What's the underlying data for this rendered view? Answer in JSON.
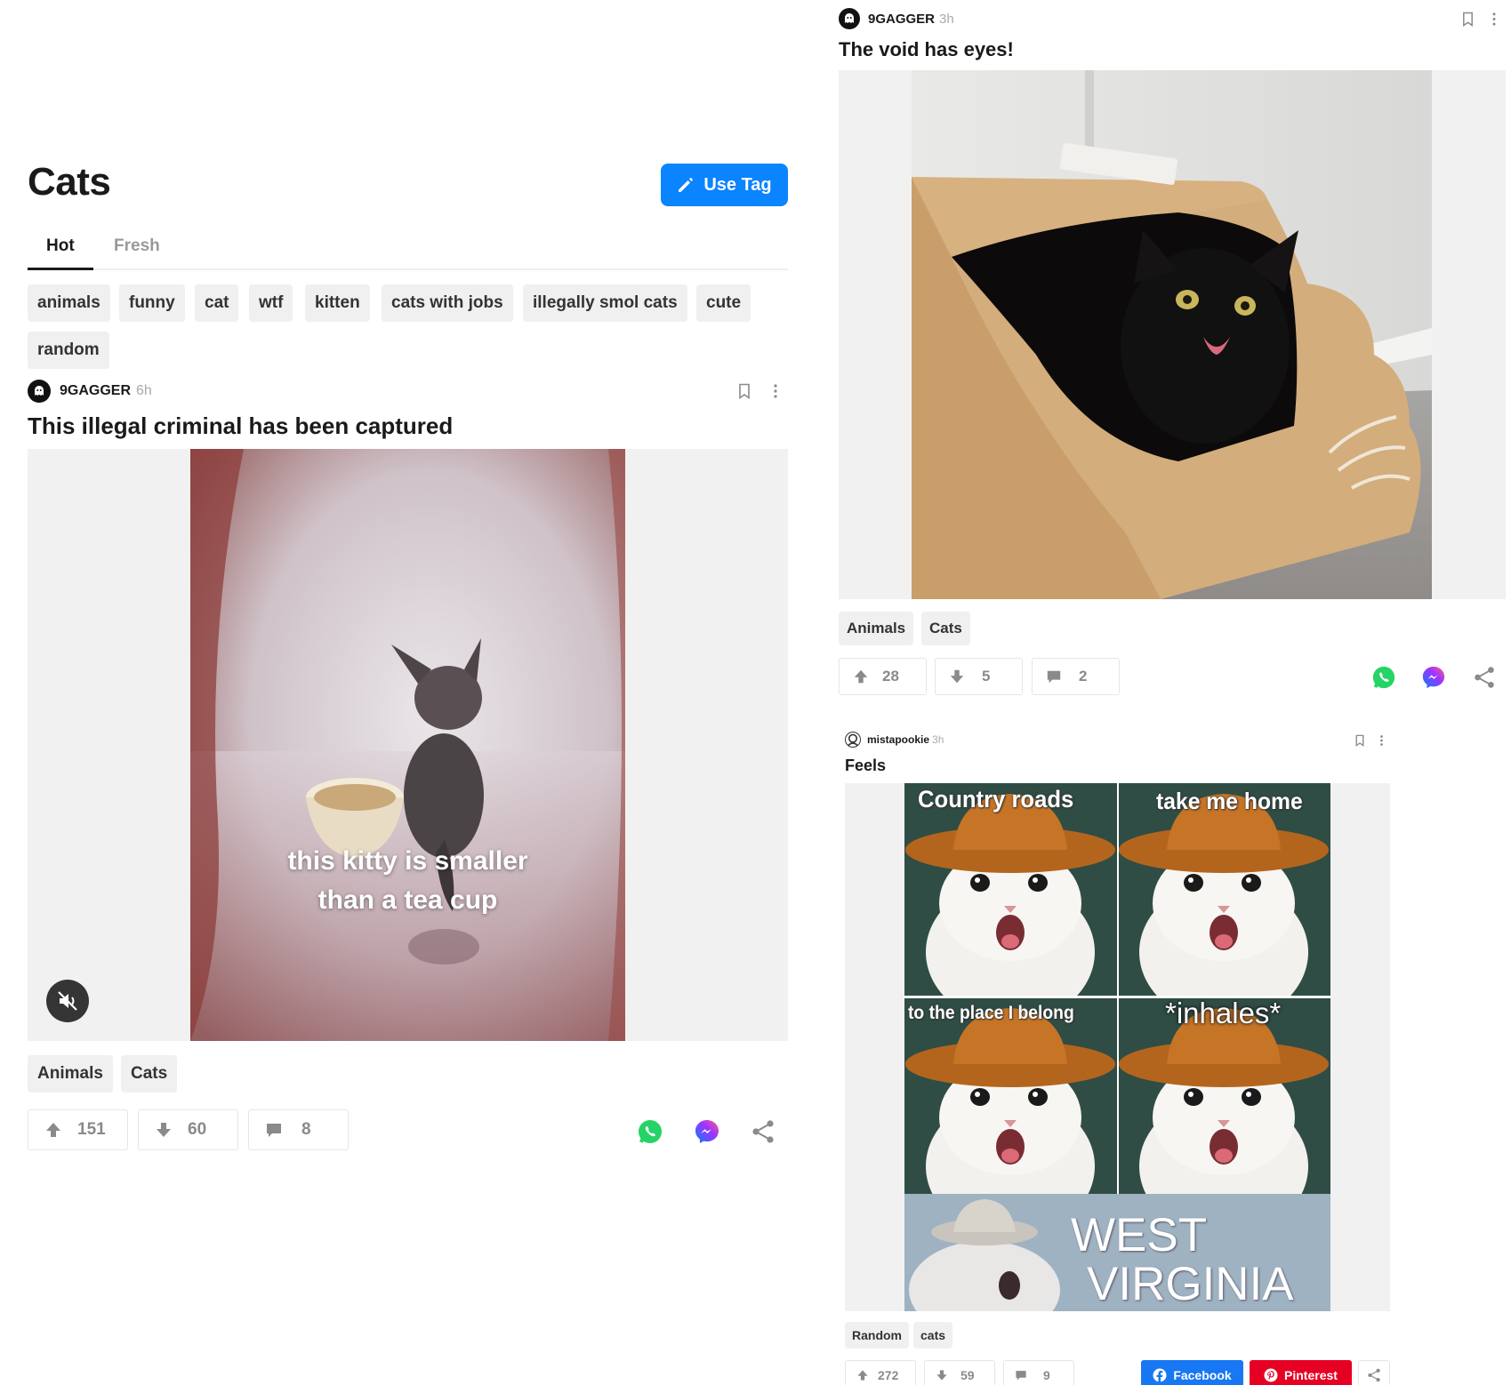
{
  "tag_page": {
    "title": "Cats",
    "use_tag_label": "Use Tag",
    "tabs": [
      {
        "label": "Hot",
        "active": true
      },
      {
        "label": "Fresh",
        "active": false
      }
    ],
    "related_tags": [
      "animals",
      "funny",
      "cat",
      "wtf",
      "kitten",
      "cats with jobs",
      "illegally smol cats",
      "cute",
      "random"
    ]
  },
  "posts": [
    {
      "author": "9GAGGER",
      "time": "6h",
      "title": "This illegal criminal has been captured",
      "media_caption": [
        "this kitty is smaller",
        "than a tea cup"
      ],
      "tags": [
        "Animals",
        "Cats"
      ],
      "upvotes": "151",
      "downvotes": "60",
      "comments": "8"
    },
    {
      "author": "9GAGGER",
      "time": "3h",
      "title": "The void has eyes!",
      "tags": [
        "Animals",
        "Cats"
      ],
      "upvotes": "28",
      "downvotes": "5",
      "comments": "2"
    },
    {
      "author": "mistapookie",
      "time": "3h",
      "title": "Feels",
      "meme_text": [
        "Country roads",
        "take me home",
        "to the place I belong",
        "*inhales*",
        "WEST",
        "VIRGINIA"
      ],
      "tags": [
        "Random",
        "cats"
      ],
      "upvotes": "272",
      "downvotes": "59",
      "comments": "9",
      "facebook_label": "Facebook",
      "pinterest_label": "Pinterest"
    }
  ],
  "colors": {
    "accent": "#0a84ff",
    "whatsapp": "#25d366",
    "messenger": "#a033ff",
    "facebook": "#1877f2",
    "pinterest": "#e60023"
  }
}
